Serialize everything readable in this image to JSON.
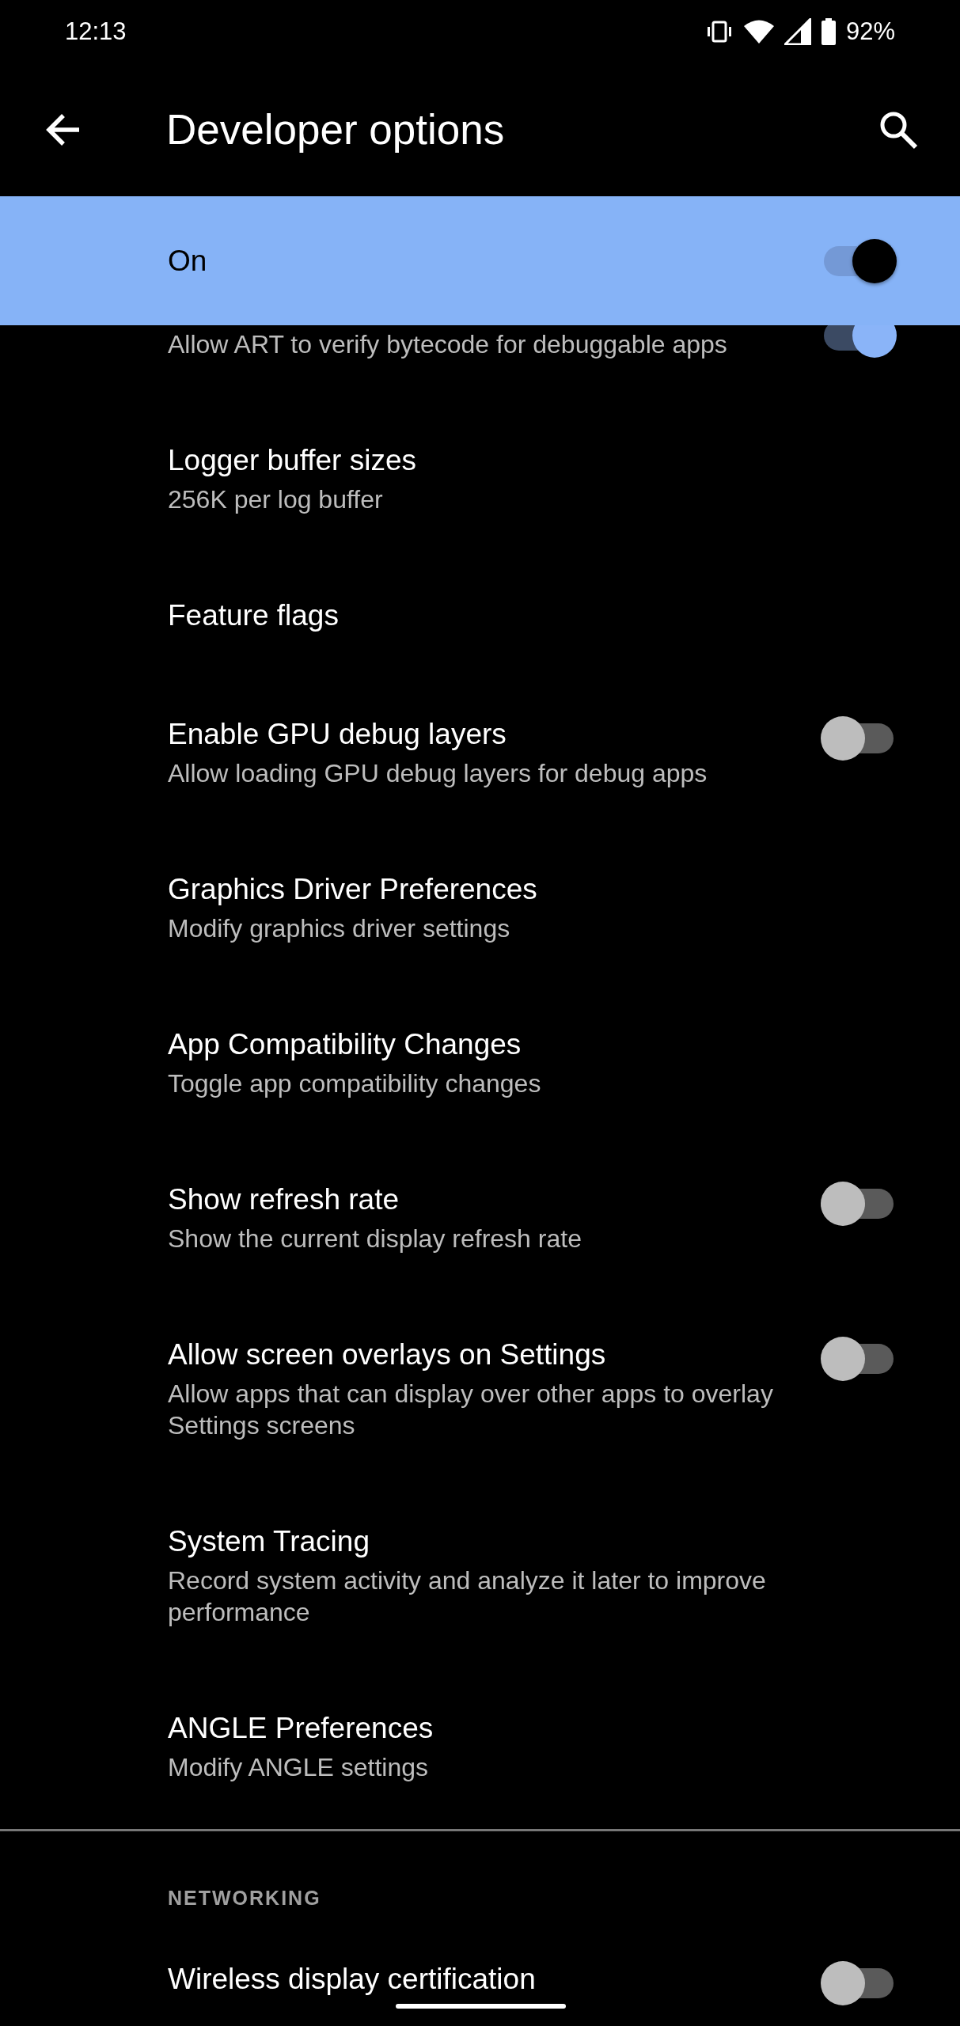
{
  "status_bar": {
    "time": "12:13",
    "battery": "92%"
  },
  "toolbar": {
    "title": "Developer options"
  },
  "master_switch": {
    "label": "On",
    "on": true
  },
  "sections": [
    {
      "items": [
        {
          "kind": "switch",
          "summary": "Allow ART to verify bytecode for debuggable apps",
          "on": true
        },
        {
          "kind": "plain",
          "title": "Logger buffer sizes",
          "summary": "256K per log buffer"
        },
        {
          "kind": "plain",
          "title": "Feature flags"
        },
        {
          "kind": "switch",
          "title": "Enable GPU debug layers",
          "summary": "Allow loading GPU debug layers for debug apps",
          "on": false
        },
        {
          "kind": "plain",
          "title": "Graphics Driver Preferences",
          "summary": "Modify graphics driver settings"
        },
        {
          "kind": "plain",
          "title": "App Compatibility Changes",
          "summary": "Toggle app compatibility changes"
        },
        {
          "kind": "switch",
          "title": "Show refresh rate",
          "summary": "Show the current display refresh rate",
          "on": false
        },
        {
          "kind": "switch",
          "title": "Allow screen overlays on Settings",
          "summary": "Allow apps that can display over other apps to overlay Settings screens",
          "on": false
        },
        {
          "kind": "plain",
          "title": "System Tracing",
          "summary": "Record system activity and analyze it later to improve performance"
        },
        {
          "kind": "plain",
          "title": "ANGLE Preferences",
          "summary": "Modify ANGLE settings"
        }
      ]
    },
    {
      "header": "NETWORKING",
      "items": [
        {
          "kind": "switch",
          "title": "Wireless display certification",
          "on": false
        }
      ]
    }
  ]
}
